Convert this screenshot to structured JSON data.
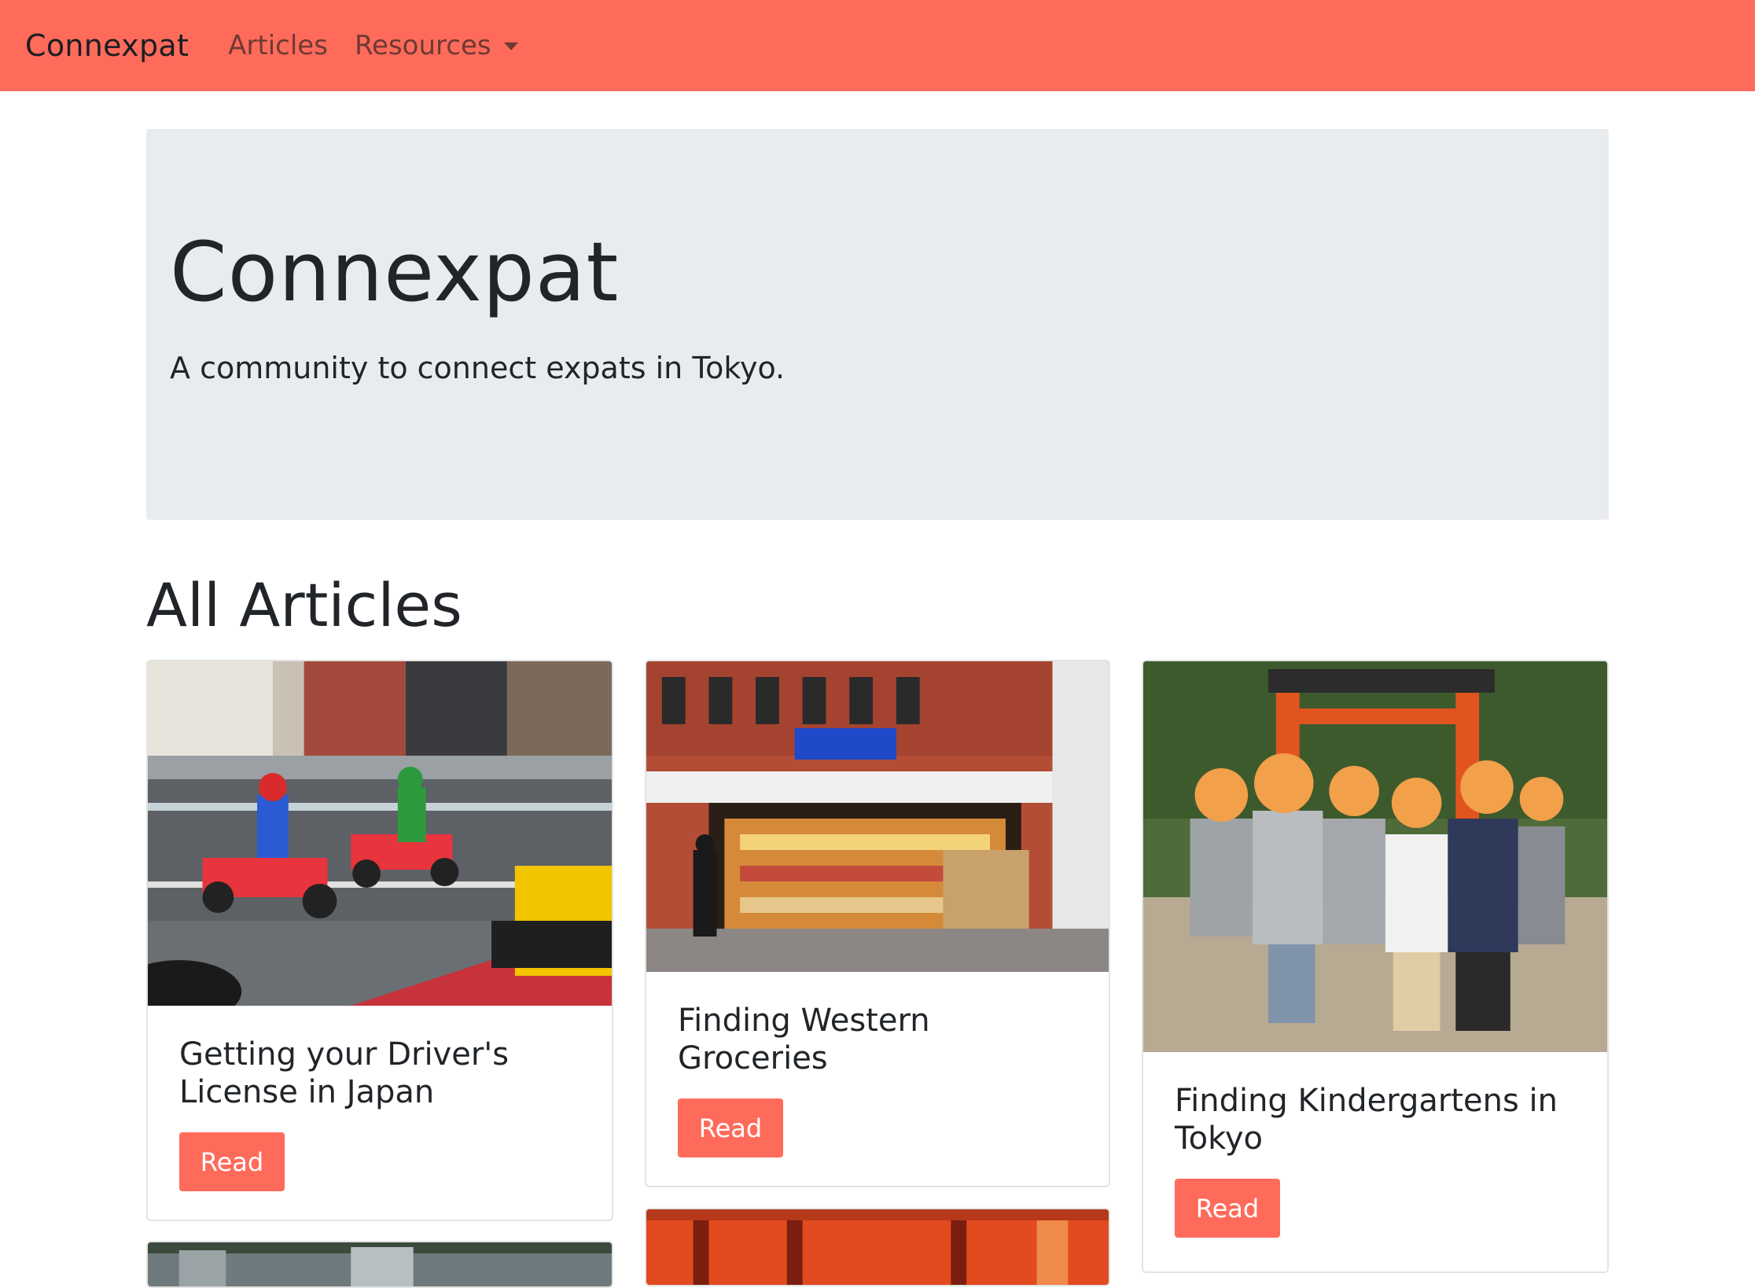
{
  "navbar": {
    "brand": "Connexpat",
    "links": [
      {
        "label": "Articles"
      },
      {
        "label": "Resources"
      }
    ]
  },
  "jumbotron": {
    "title": "Connexpat",
    "lead": "A community to connect expats in Tokyo."
  },
  "articles": {
    "heading": "All Articles",
    "cards": [
      {
        "title": "Getting your Driver's License in Japan",
        "button": "Read",
        "image": "street-go-kart-photo"
      },
      {
        "title": "Finding Western Groceries",
        "button": "Read",
        "image": "grocery-store-photo"
      },
      {
        "title": "Finding Kindergartens in Tokyo",
        "button": "Read",
        "image": "kindergarten-children-photo"
      }
    ]
  },
  "colors": {
    "accent": "#ff6b5b",
    "jumbotron_bg": "#e9ecef"
  }
}
